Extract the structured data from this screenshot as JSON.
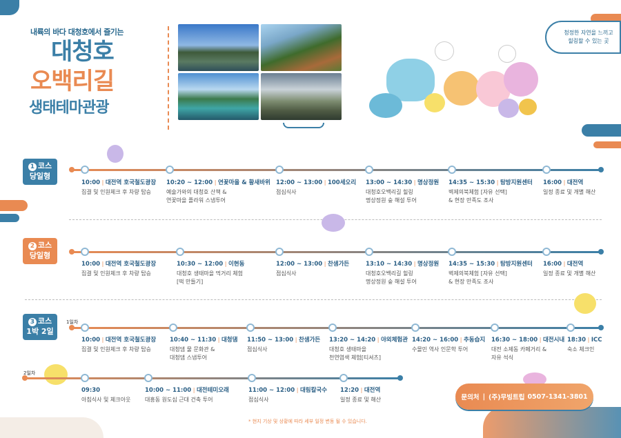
{
  "header": {
    "subtitle": "내륙의 바다 대청호에서 즐기는",
    "title_line1": "대청호",
    "title_line2": "오백리길",
    "title_line3": "생태테마관광",
    "slogan_line1": "청정한 자연을 느끼고",
    "slogan_line2": "힐링할 수 있는 곳"
  },
  "colors": {
    "blue": "#3b7fa7",
    "orange": "#e98a52",
    "navy": "#2b5f85"
  },
  "course1": {
    "badge_num": "1",
    "badge_title": "코스",
    "badge_sub": "당일형",
    "items": [
      {
        "time": "10:00",
        "place": "대전역 호국철도광장",
        "desc1": "집결 및 인원체크 후 차량 탑승",
        "desc2": ""
      },
      {
        "time": "10:20 ~ 12:00",
        "place": "연꽃마을 & 황새바위",
        "desc1": "예술가와의 대청호 산책 &",
        "desc2": "연꽃마을 플라워 스냅투어"
      },
      {
        "time": "12:00 ~ 13:00",
        "place": "100세오리",
        "desc1": "점심식사",
        "desc2": ""
      },
      {
        "time": "13:00 ~ 14:30",
        "place": "명상정원",
        "desc1": "대청호오백리길 힐링",
        "desc2": "명상정원 숲 해설 투어"
      },
      {
        "time": "14:35 ~ 15:30",
        "place": "탐방지원센터",
        "desc1": "벽제의북체험 [자유 선택]",
        "desc2": "& 현장 만족도 조사"
      },
      {
        "time": "16:00",
        "place": "대전역",
        "desc1": "일정 종료 및 개별 해산",
        "desc2": ""
      }
    ]
  },
  "course2": {
    "badge_num": "2",
    "badge_title": "코스",
    "badge_sub": "당일형",
    "items": [
      {
        "time": "10:00",
        "place": "대전역 호국철도광장",
        "desc1": "집결 및 인원체크 후 차량 탑승",
        "desc2": ""
      },
      {
        "time": "10:30 ~ 12:00",
        "place": "이현동",
        "desc1": "대청호 생태마을 먹거리 체험",
        "desc2": "[떡 만들기]"
      },
      {
        "time": "12:00 ~ 13:00",
        "place": "찬샘가든",
        "desc1": "점심식사",
        "desc2": ""
      },
      {
        "time": "13:10 ~ 14:30",
        "place": "명상정원",
        "desc1": "대청호오백리길 힐링",
        "desc2": "명상정원 숲 해설 투어"
      },
      {
        "time": "14:35 ~ 15:30",
        "place": "탐방지원센터",
        "desc1": "벽제의북체험 [자유 선택]",
        "desc2": "& 현장 만족도 조사"
      },
      {
        "time": "16:00",
        "place": "대전역",
        "desc1": "일정 종료 및 개별 해산",
        "desc2": ""
      }
    ]
  },
  "course3": {
    "badge_num": "3",
    "badge_title": "코스",
    "badge_sub": "1박 2일",
    "day1_label": "1일차",
    "day2_label": "2일차",
    "day1": [
      {
        "time": "10:00",
        "place": "대전역 호국철도광장",
        "desc1": "집결 및 인원체크 후 차량 탑승",
        "desc2": ""
      },
      {
        "time": "10:40 ~ 11:30",
        "place": "대청댐",
        "desc1": "대청댐 물 문화관 &",
        "desc2": "대청댐 스냅투어"
      },
      {
        "time": "11:50 ~ 13:00",
        "place": "찬샘가든",
        "desc1": "점심식사",
        "desc2": ""
      },
      {
        "time": "13:20 ~ 14:20",
        "place": "야외체험관",
        "desc1": "대청호 생태마을",
        "desc2": "천연염색 체험[티셔츠]"
      },
      {
        "time": "14:20 ~ 16:00",
        "place": "추동습지",
        "desc1": "수몰민 역사 인문학 투어",
        "desc2": ""
      },
      {
        "time": "16:30 ~ 18:00",
        "place": "대전시내",
        "desc1": "대전 소제동 카페거리 &",
        "desc2": "자유 석식"
      },
      {
        "time": "18:30",
        "place": "ICC",
        "desc1": "숙소 체크인",
        "desc2": ""
      }
    ],
    "day2": [
      {
        "time": "09:30",
        "place": "",
        "desc1": "아침식사 및 체크아웃",
        "desc2": ""
      },
      {
        "time": "10:00 ~ 11:00",
        "place": "대전테미오래",
        "desc1": "대흥동 원도심 근대 건축 투어",
        "desc2": ""
      },
      {
        "time": "11:00 ~ 12:00",
        "place": "대림칼국수",
        "desc1": "점심식사",
        "desc2": ""
      },
      {
        "time": "12:20",
        "place": "대전역",
        "desc1": "일정 종료 및 해산",
        "desc2": ""
      }
    ]
  },
  "contact": {
    "label": "문의처",
    "company": "(주)무빙트립",
    "phone": "0507-1341-3801"
  },
  "note": "* 현지 기상 및 상황에 따라 세부 일정 변동 될 수 있습니다."
}
